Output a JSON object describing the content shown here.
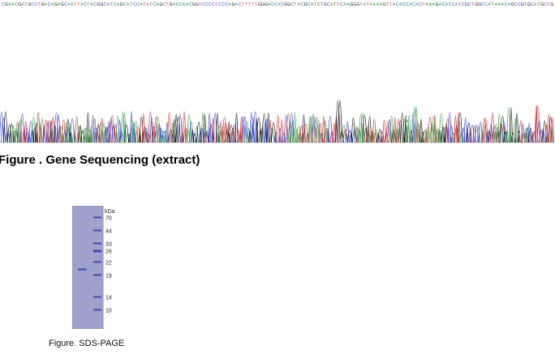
{
  "gene_sequencing": {
    "caption": "Figure . Gene Sequencing (extract)",
    "base_colors": {
      "A": "#2e9e3f",
      "C": "#2e3fd0",
      "G": "#111111",
      "T": "#d02020"
    }
  },
  "sds_page": {
    "caption": "Figure. SDS-PAGE",
    "unit": "kDa",
    "markers": [
      "70",
      "44",
      "33",
      "26",
      "22",
      "19",
      "14",
      "10"
    ],
    "gel_color": "#9ea1cc",
    "band_color": "#3c4fa6"
  }
}
